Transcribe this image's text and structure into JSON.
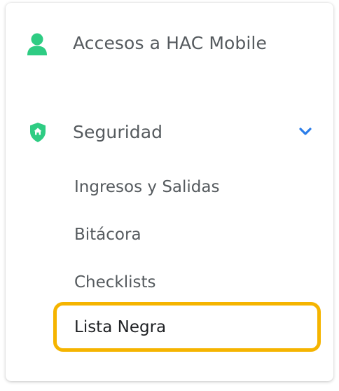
{
  "menu": {
    "hac_mobile": {
      "label": "Accesos a HAC Mobile",
      "icon": "user-icon"
    },
    "security": {
      "label": "Seguridad",
      "icon": "shield-home-icon",
      "expanded": true,
      "expand_icon": "chevron-down-icon",
      "items": [
        {
          "label": "Ingresos y Salidas"
        },
        {
          "label": "Bitácora"
        },
        {
          "label": "Checklists"
        },
        {
          "label": "Lista Negra",
          "highlighted": true
        }
      ]
    }
  },
  "colors": {
    "icon_green": "#2ecc83",
    "chevron_blue": "#2b7de9",
    "highlight": "#f5b400",
    "text": "#555a5e",
    "text_active": "#1f2124"
  }
}
